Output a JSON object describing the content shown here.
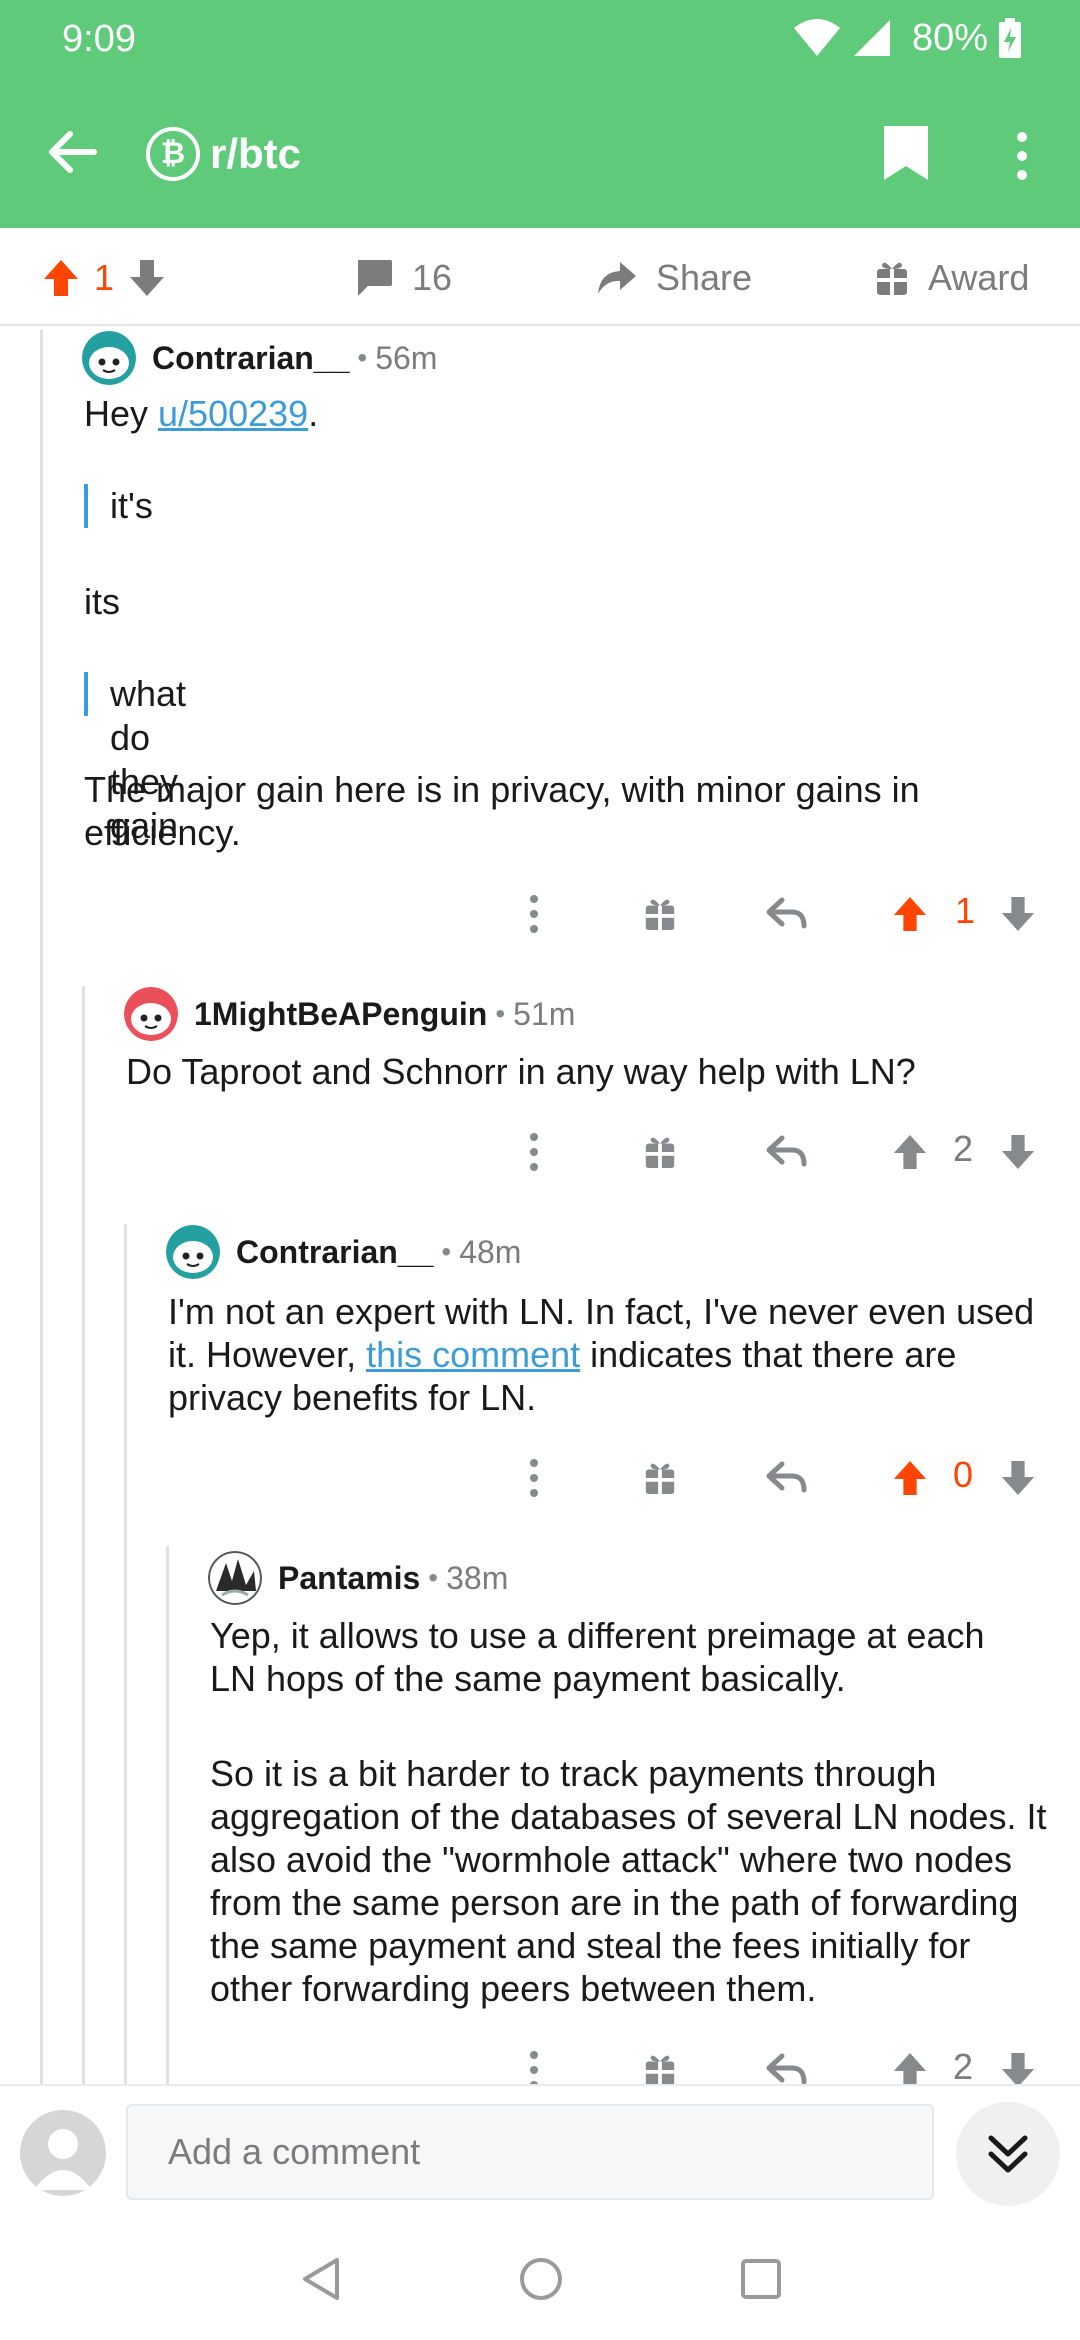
{
  "status_bar": {
    "time": "9:09",
    "battery": "80%"
  },
  "header": {
    "subreddit": "r/btc",
    "subreddit_icon": "₿"
  },
  "post_actions": {
    "score": "1",
    "comments_count": "16",
    "share_label": "Share",
    "award_label": "Award"
  },
  "comments": [
    {
      "username": "Contrarian__",
      "separator": "•",
      "time": "56m",
      "greeting_prefix": "Hey ",
      "mention": "u/500239",
      "greeting_suffix": ".",
      "quote1": "it's",
      "plain1": "its",
      "quote2": "what do they gain",
      "paragraph": "The major gain here is in privacy, with minor gains in efficiency.",
      "score": "1",
      "vote_state": "up"
    },
    {
      "username": "1MightBeAPenguin",
      "separator": "•",
      "time": "51m",
      "body": "Do Taproot and Schnorr in any way help with LN?",
      "score": "2",
      "vote_state": "none"
    },
    {
      "username": "Contrarian__",
      "separator": "•",
      "time": "48m",
      "body_part1": "I'm not an expert with LN. In fact, I've never even used it. However, ",
      "link_text": "this comment",
      "body_part2": " indicates that there are privacy benefits for LN.",
      "score": "0",
      "vote_state": "up"
    },
    {
      "username": "Pantamis",
      "separator": "•",
      "time": "38m",
      "paragraph1": "Yep, it allows to use a different preimage at each LN hops of the same payment basically.",
      "paragraph2": "So it is a bit harder to track payments through aggregation of the databases of several LN nodes. It also avoid the \"wormhole attack\" where two nodes from the same person are in the path of forwarding the same payment and steal the fees initially for other forwarding peers between them.",
      "score": "2",
      "vote_state": "none"
    }
  ],
  "comment_bar": {
    "placeholder": "Add a comment"
  },
  "colors": {
    "header": "#5fca7a",
    "upvote": "#ff4500",
    "link": "#3d9bd6",
    "meta": "#7c7c7c"
  },
  "icons": [
    "back-arrow-icon",
    "bitcoin-icon",
    "bookmark-icon",
    "more-vert-icon",
    "upvote-icon",
    "downvote-icon",
    "comment-icon",
    "share-icon",
    "award-icon",
    "reply-icon",
    "chevron-double-down-icon"
  ]
}
